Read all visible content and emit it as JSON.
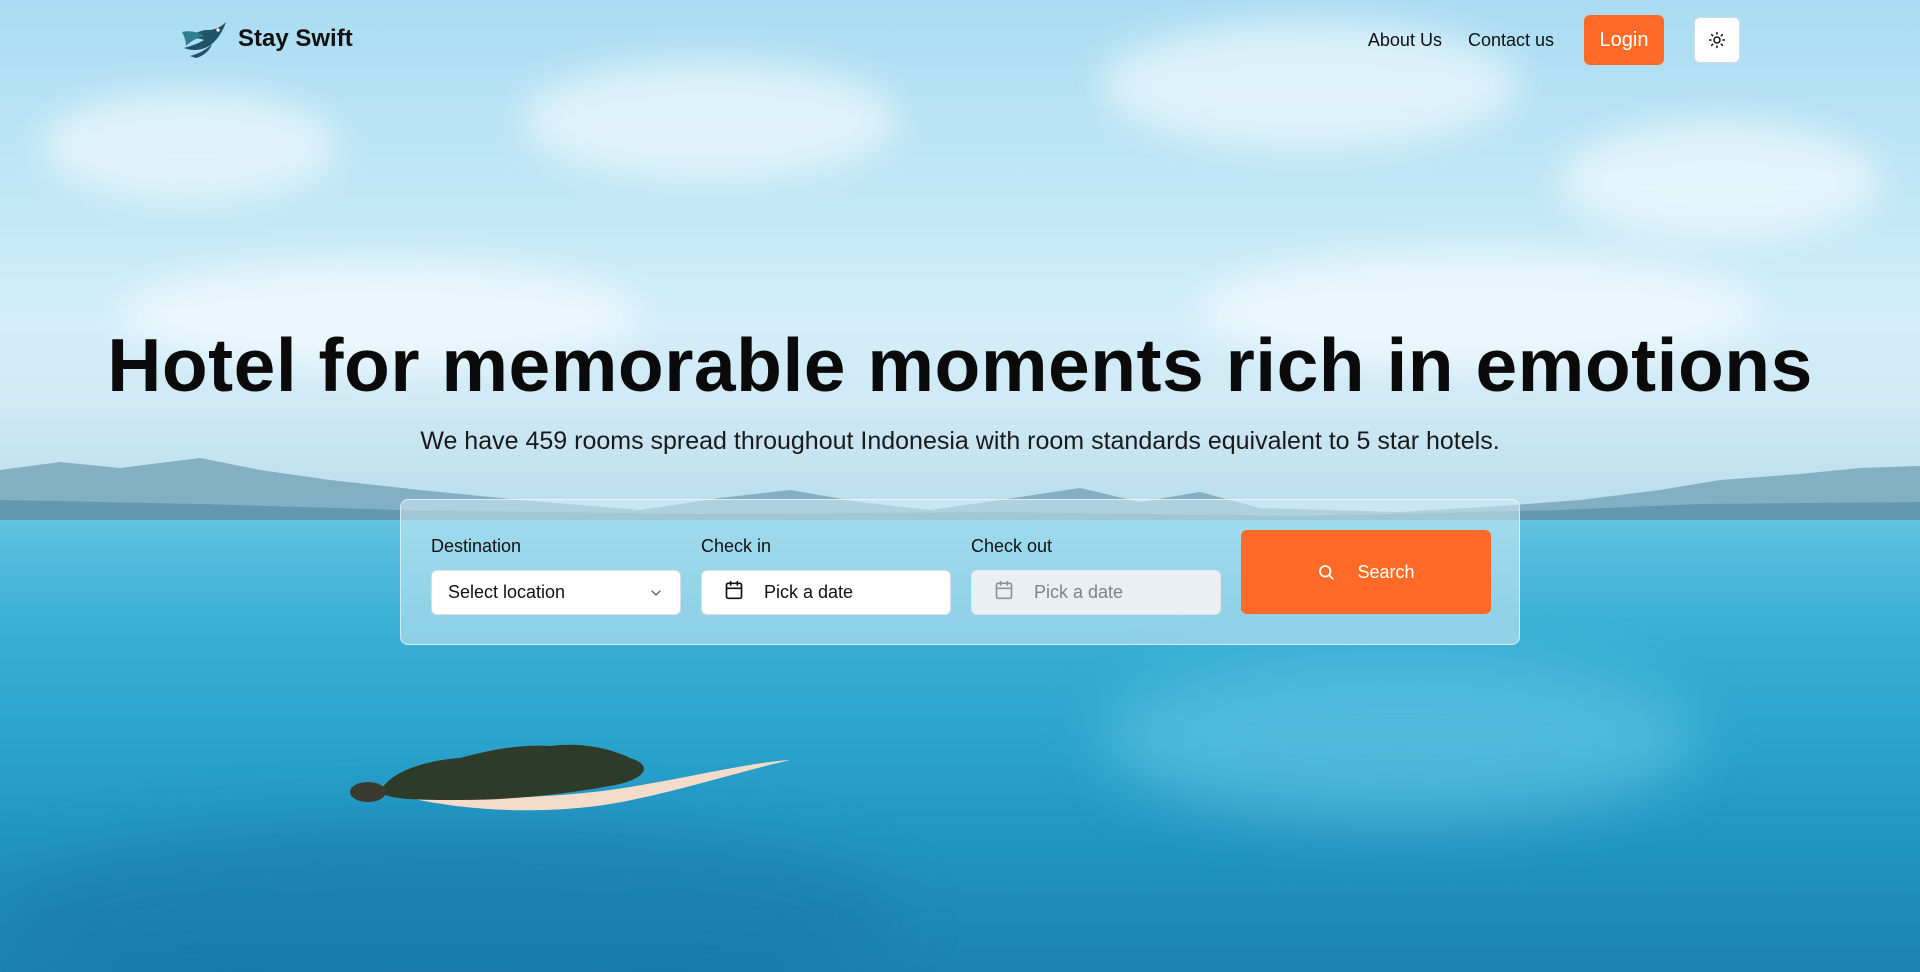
{
  "brand": {
    "name": "Stay Swift",
    "logo": "swift-bird-logo"
  },
  "nav": {
    "about_label": "About Us",
    "contact_label": "Contact us",
    "login_label": "Login",
    "theme_toggle_icon": "sun-icon"
  },
  "hero": {
    "title": "Hotel for memorable moments rich in emotions",
    "subtitle": "We have 459 rooms spread throughout Indonesia with room standards equivalent to 5 star hotels."
  },
  "search": {
    "destination": {
      "label": "Destination",
      "value": "Select location",
      "icon": "chevron-down-icon"
    },
    "check_in": {
      "label": "Check in",
      "value": "Pick a date",
      "icon": "calendar-icon"
    },
    "check_out": {
      "label": "Check out",
      "value": "Pick a date",
      "icon": "calendar-icon",
      "disabled": true
    },
    "button_label": "Search",
    "button_icon": "search-icon"
  },
  "colors": {
    "accent": "#ff6a28",
    "text": "#0a0a0a",
    "sky": "#bfe6f6",
    "sea": "#2aa2cc"
  }
}
